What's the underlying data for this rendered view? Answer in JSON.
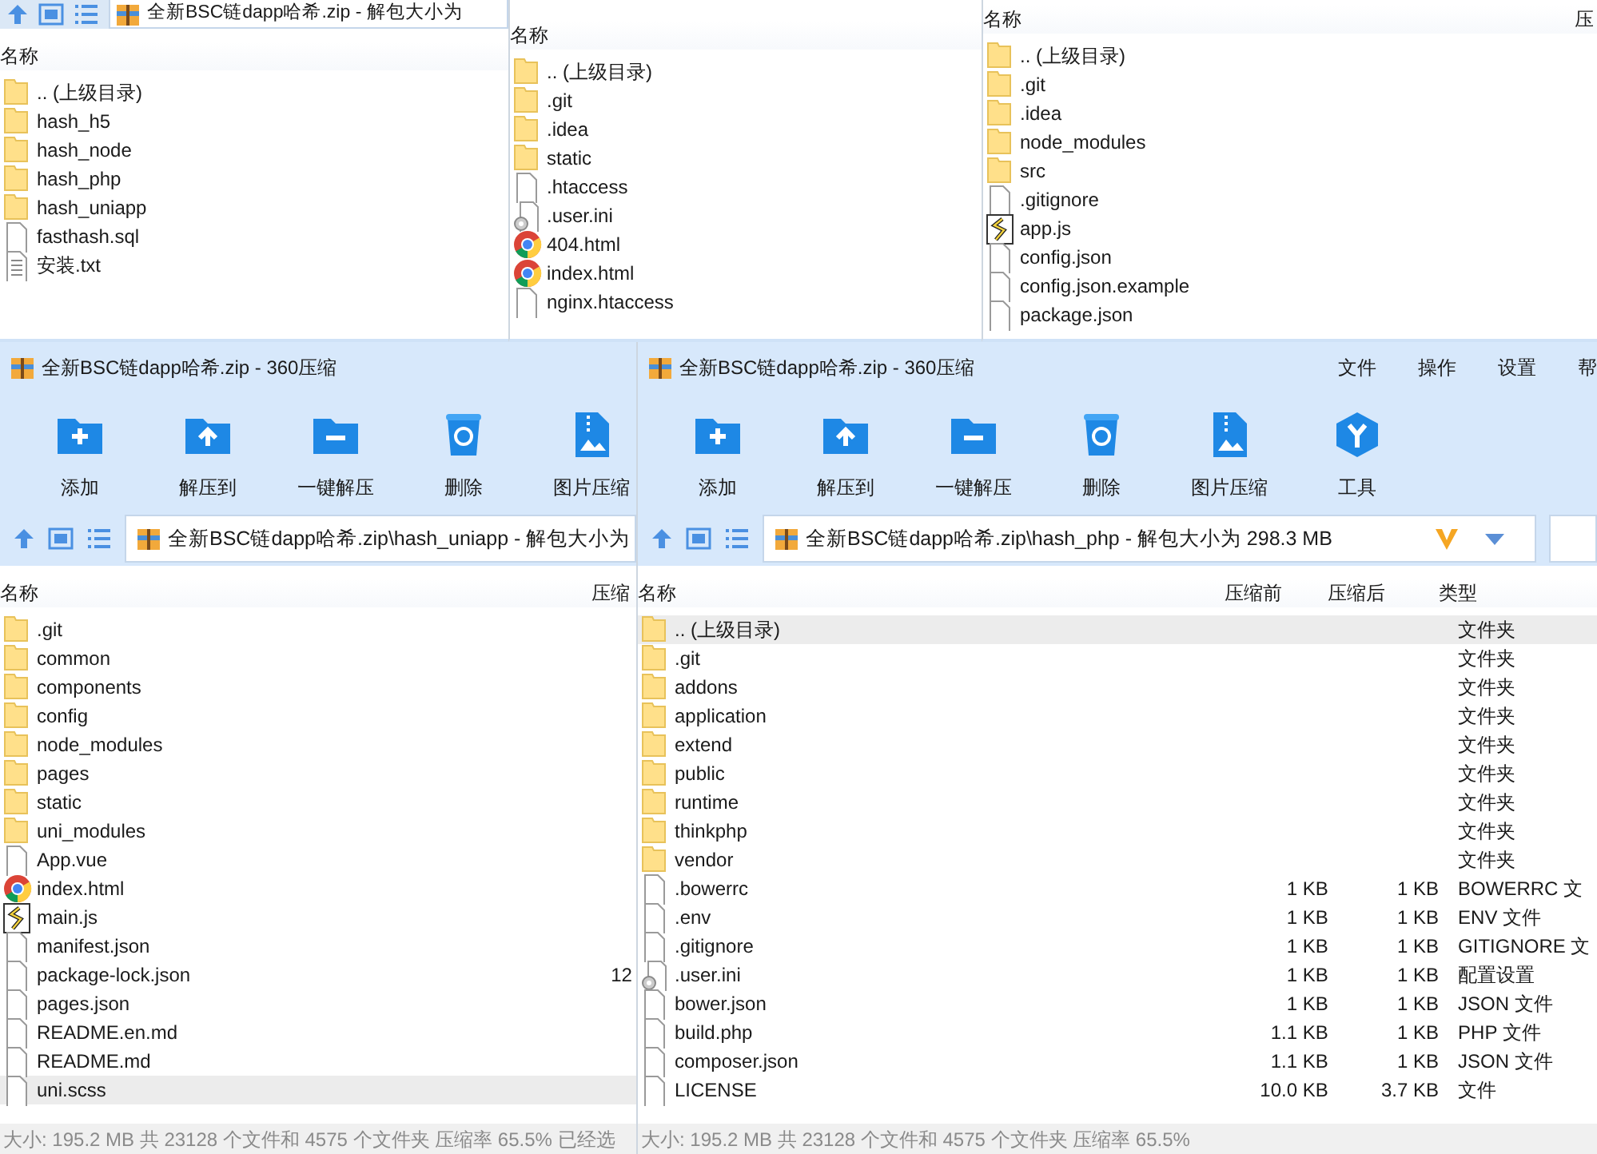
{
  "windows": [
    {
      "path": "全新BSC链dapp哈希.zip - 解包大小为",
      "columns": [
        "名称"
      ],
      "rows": [
        {
          "kind": "folder",
          "cells": [
            ".. (上级目录)"
          ],
          "selected": false
        },
        {
          "kind": "folder",
          "cells": [
            "hash_h5"
          ],
          "selected": false
        },
        {
          "kind": "folder",
          "cells": [
            "hash_node"
          ],
          "selected": false
        },
        {
          "kind": "folder",
          "cells": [
            "hash_php"
          ],
          "selected": false
        },
        {
          "kind": "folder",
          "cells": [
            "hash_uniapp"
          ],
          "selected": false
        },
        {
          "kind": "file",
          "cells": [
            "fasthash.sql"
          ],
          "selected": false
        },
        {
          "kind": "text",
          "cells": [
            "安装.txt"
          ],
          "selected": false
        }
      ]
    },
    {
      "columns": [
        "名称"
      ],
      "rows": [
        {
          "kind": "folder",
          "cells": [
            ".. (上级目录)"
          ],
          "selected": false
        },
        {
          "kind": "folder",
          "cells": [
            ".git"
          ],
          "selected": false
        },
        {
          "kind": "folder",
          "cells": [
            ".idea"
          ],
          "selected": false
        },
        {
          "kind": "folder",
          "cells": [
            "static"
          ],
          "selected": false
        },
        {
          "kind": "file",
          "cells": [
            ".htaccess"
          ],
          "selected": false
        },
        {
          "kind": "gear",
          "cells": [
            ".user.ini"
          ],
          "selected": false
        },
        {
          "kind": "browser",
          "cells": [
            "404.html"
          ],
          "selected": false
        },
        {
          "kind": "browser",
          "cells": [
            "index.html"
          ],
          "selected": false
        },
        {
          "kind": "file",
          "cells": [
            "nginx.htaccess"
          ],
          "selected": false
        }
      ]
    },
    {
      "columns": [
        "名称",
        "压"
      ],
      "rows": [
        {
          "kind": "folder",
          "cells": [
            ".. (上级目录)"
          ],
          "selected": false
        },
        {
          "kind": "folder",
          "cells": [
            ".git"
          ],
          "selected": false
        },
        {
          "kind": "folder",
          "cells": [
            ".idea"
          ],
          "selected": false
        },
        {
          "kind": "folder",
          "cells": [
            "node_modules"
          ],
          "selected": false
        },
        {
          "kind": "folder",
          "cells": [
            "src"
          ],
          "selected": false
        },
        {
          "kind": "file",
          "cells": [
            ".gitignore"
          ],
          "selected": false
        },
        {
          "kind": "script",
          "cells": [
            "app.js"
          ],
          "selected": false
        },
        {
          "kind": "file",
          "cells": [
            "config.json"
          ],
          "selected": false
        },
        {
          "kind": "file",
          "cells": [
            "config.json.example"
          ],
          "selected": false
        },
        {
          "kind": "file",
          "cells": [
            "package.json"
          ],
          "selected": false
        }
      ]
    },
    {
      "title": "全新BSC链dapp哈希.zip - 360压缩",
      "tools": [
        {
          "kind": "add",
          "label": "添加"
        },
        {
          "kind": "extract",
          "label": "解压到"
        },
        {
          "kind": "quick",
          "label": "一键解压"
        },
        {
          "kind": "delete",
          "label": "删除"
        },
        {
          "kind": "image",
          "label": "图片压缩"
        }
      ],
      "path": "全新BSC链dapp哈希.zip\\hash_uniapp - 解包大小为",
      "columns": [
        "名称",
        "压缩"
      ],
      "rows": [
        {
          "kind": "folder",
          "cells": [
            ".git"
          ],
          "selected": false
        },
        {
          "kind": "folder",
          "cells": [
            "common"
          ],
          "selected": false
        },
        {
          "kind": "folder",
          "cells": [
            "components"
          ],
          "selected": false
        },
        {
          "kind": "folder",
          "cells": [
            "config"
          ],
          "selected": false
        },
        {
          "kind": "folder",
          "cells": [
            "node_modules"
          ],
          "selected": false
        },
        {
          "kind": "folder",
          "cells": [
            "pages"
          ],
          "selected": false
        },
        {
          "kind": "folder",
          "cells": [
            "static"
          ],
          "selected": false
        },
        {
          "kind": "folder",
          "cells": [
            "uni_modules"
          ],
          "selected": false
        },
        {
          "kind": "file",
          "cells": [
            "App.vue"
          ],
          "selected": false
        },
        {
          "kind": "browser",
          "cells": [
            "index.html"
          ],
          "selected": false
        },
        {
          "kind": "script",
          "cells": [
            "main.js"
          ],
          "selected": false
        },
        {
          "kind": "file",
          "cells": [
            "manifest.json"
          ],
          "selected": false
        },
        {
          "kind": "file",
          "cells": [
            "package-lock.json",
            "12"
          ],
          "selected": false
        },
        {
          "kind": "file",
          "cells": [
            "pages.json"
          ],
          "selected": false
        },
        {
          "kind": "file",
          "cells": [
            "README.en.md"
          ],
          "selected": false
        },
        {
          "kind": "file",
          "cells": [
            "README.md"
          ],
          "selected": false
        },
        {
          "kind": "file",
          "cells": [
            "uni.scss"
          ],
          "selected": true
        }
      ],
      "status": "大小: 195.2 MB 共 23128 个文件和 4575 个文件夹 压缩率 65.5% 已经选"
    },
    {
      "title": "全新BSC链dapp哈希.zip - 360压缩",
      "menu": [
        "文件",
        "操作",
        "设置",
        "帮"
      ],
      "tools": [
        {
          "kind": "add",
          "label": "添加"
        },
        {
          "kind": "extract",
          "label": "解压到"
        },
        {
          "kind": "quick",
          "label": "一键解压"
        },
        {
          "kind": "delete",
          "label": "删除"
        },
        {
          "kind": "image",
          "label": "图片压缩"
        },
        {
          "kind": "tool",
          "label": "工具"
        }
      ],
      "path": "全新BSC链dapp哈希.zip\\hash_php - 解包大小为 298.3 MB",
      "columns": [
        "名称",
        "压缩前",
        "压缩后",
        "类型"
      ],
      "rows": [
        {
          "kind": "folder",
          "cells": [
            ".. (上级目录)",
            "",
            "",
            "文件夹"
          ],
          "selected": true
        },
        {
          "kind": "folder",
          "cells": [
            ".git",
            "",
            "",
            "文件夹"
          ],
          "selected": false
        },
        {
          "kind": "folder",
          "cells": [
            "addons",
            "",
            "",
            "文件夹"
          ],
          "selected": false
        },
        {
          "kind": "folder",
          "cells": [
            "application",
            "",
            "",
            "文件夹"
          ],
          "selected": false
        },
        {
          "kind": "folder",
          "cells": [
            "extend",
            "",
            "",
            "文件夹"
          ],
          "selected": false
        },
        {
          "kind": "folder",
          "cells": [
            "public",
            "",
            "",
            "文件夹"
          ],
          "selected": false
        },
        {
          "kind": "folder",
          "cells": [
            "runtime",
            "",
            "",
            "文件夹"
          ],
          "selected": false
        },
        {
          "kind": "folder",
          "cells": [
            "thinkphp",
            "",
            "",
            "文件夹"
          ],
          "selected": false
        },
        {
          "kind": "folder",
          "cells": [
            "vendor",
            "",
            "",
            "文件夹"
          ],
          "selected": false
        },
        {
          "kind": "file",
          "cells": [
            ".bowerrc",
            "1 KB",
            "1 KB",
            "BOWERRC 文"
          ],
          "selected": false
        },
        {
          "kind": "file",
          "cells": [
            ".env",
            "1 KB",
            "1 KB",
            "ENV 文件"
          ],
          "selected": false
        },
        {
          "kind": "file",
          "cells": [
            ".gitignore",
            "1 KB",
            "1 KB",
            "GITIGNORE 文"
          ],
          "selected": false
        },
        {
          "kind": "gear",
          "cells": [
            ".user.ini",
            "1 KB",
            "1 KB",
            "配置设置"
          ],
          "selected": false
        },
        {
          "kind": "file",
          "cells": [
            "bower.json",
            "1 KB",
            "1 KB",
            "JSON 文件"
          ],
          "selected": false
        },
        {
          "kind": "file",
          "cells": [
            "build.php",
            "1.1 KB",
            "1 KB",
            "PHP 文件"
          ],
          "selected": false
        },
        {
          "kind": "file",
          "cells": [
            "composer.json",
            "1.1 KB",
            "1 KB",
            "JSON 文件"
          ],
          "selected": false
        },
        {
          "kind": "file",
          "cells": [
            "LICENSE",
            "10.0 KB",
            "3.7 KB",
            "文件"
          ],
          "selected": false
        }
      ],
      "status": "大小: 195.2 MB 共 23128 个文件和 4575 个文件夹 压缩率 65.5%"
    }
  ]
}
